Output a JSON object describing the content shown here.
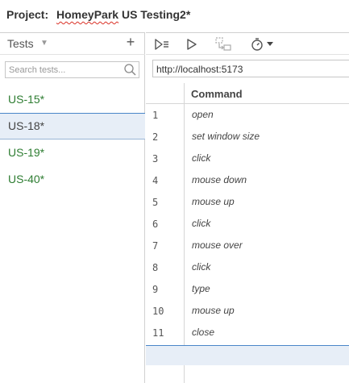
{
  "header": {
    "project_label": "Project:",
    "project_name": "HomeyPark",
    "project_rest": "US Testing2*"
  },
  "sidebar": {
    "title": "Tests",
    "add_label": "+",
    "search_placeholder": "Search tests...",
    "tests": [
      {
        "name": "US-15*",
        "selected": false
      },
      {
        "name": "US-18*",
        "selected": true
      },
      {
        "name": "US-19*",
        "selected": false
      },
      {
        "name": "US-40*",
        "selected": false
      }
    ]
  },
  "toolbar": {
    "icons": [
      "run-all-icon",
      "run-test-icon",
      "step-icon",
      "speed-timer-icon",
      "dropdown-caret-icon"
    ]
  },
  "url": {
    "value": "http://localhost:5173"
  },
  "table": {
    "command_header": "Command",
    "rows": [
      {
        "num": "1",
        "command": "open"
      },
      {
        "num": "2",
        "command": "set window size"
      },
      {
        "num": "3",
        "command": "click"
      },
      {
        "num": "4",
        "command": "mouse down"
      },
      {
        "num": "5",
        "command": "mouse up"
      },
      {
        "num": "6",
        "command": "click"
      },
      {
        "num": "7",
        "command": "mouse over"
      },
      {
        "num": "8",
        "command": "click"
      },
      {
        "num": "9",
        "command": "type"
      },
      {
        "num": "10",
        "command": "mouse up"
      },
      {
        "num": "11",
        "command": "close"
      }
    ]
  },
  "colors": {
    "test_green": "#2e7d32",
    "selection_bg": "#e7eef7",
    "selection_border": "#4a86c8"
  }
}
